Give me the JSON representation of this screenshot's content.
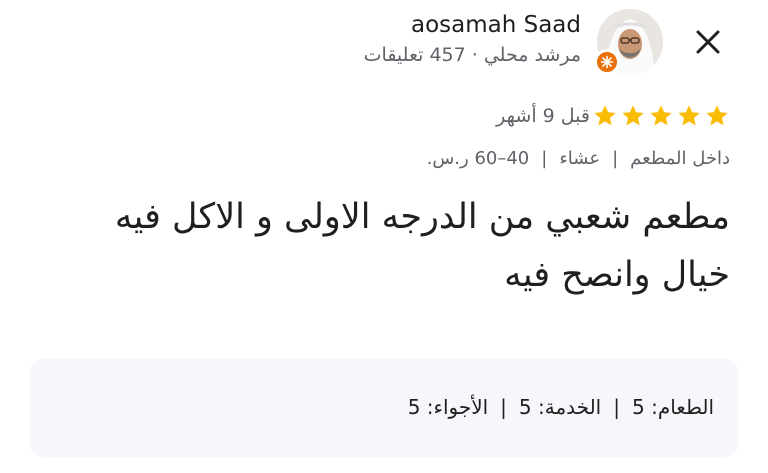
{
  "reviewer": {
    "name": "aosamah Saad",
    "meta": "مرشد محلي · 457 تعليقات"
  },
  "review": {
    "stars": 5,
    "time": "قبل 9 أشهر",
    "tags": [
      "داخل المطعم",
      "عشاء",
      "40–60 ر.س."
    ],
    "text": "مطعم شعبي من الدرجه الاولى و الاكل فيه خيال وانصح فيه"
  },
  "ratings": [
    "الطعام: 5",
    "الخدمة: 5",
    "الأجواء: 5"
  ],
  "colors": {
    "star": "#fbbc04",
    "badge": "#e8710a",
    "box_bg": "#f6f7fa"
  }
}
